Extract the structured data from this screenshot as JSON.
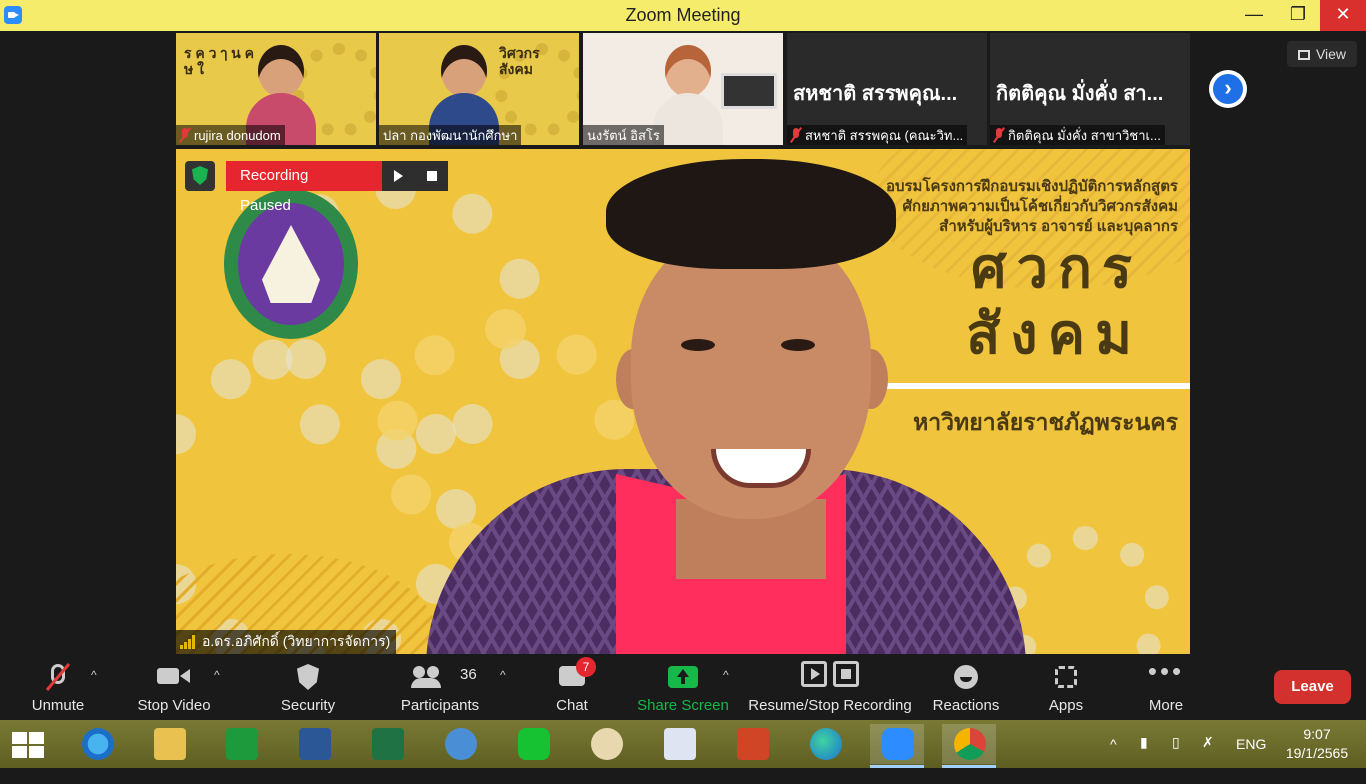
{
  "window": {
    "title": "Zoom Meeting"
  },
  "gallery": {
    "view_label": "View",
    "tiles": [
      {
        "name": "rujira donudom",
        "poster": "ร ค ว ๅ น ค ษ ใ"
      },
      {
        "name": "ปลา กองพัฒนานักศึกษา",
        "poster": "วิศวกร สังคม"
      },
      {
        "name": "นงรัตน์ อิสโร"
      },
      {
        "name": "สหชาติ สรรพคุณ (คณะวิท...",
        "big": "สหชาติ สรรพคุณ..."
      },
      {
        "name": "กิตติคุณ  มั่งคั่ง สาขาวิชาเ...",
        "big": "กิตติคุณ  มั่งคั่ง สา..."
      }
    ]
  },
  "main": {
    "recording_label": "Recording Paused",
    "speaker_name": "อ.ดร.อภิศักดิ์ (วิทยาการจัดการ)",
    "poster": {
      "line1": "อบรมโครงการฝึกอบรมเชิงปฏิบัติการหลักสูตร",
      "line2": "ศักยภาพความเป็นโค้ชเกี่ยวกับวิศวกรสังคม",
      "line3": "สำหรับผู้บริหาร อาจารย์ และบุคลากร",
      "big1": "ศวกร",
      "big2": "สังคม",
      "university": "หาวิทยาลัยราชภัฏพระนคร"
    }
  },
  "toolbar": {
    "unmute": "Unmute",
    "stop_video": "Stop Video",
    "security": "Security",
    "participants": "Participants",
    "participants_count": "36",
    "chat": "Chat",
    "chat_badge": "7",
    "share_screen": "Share Screen",
    "recording": "Resume/Stop Recording",
    "reactions": "Reactions",
    "apps": "Apps",
    "more": "More",
    "leave": "Leave"
  },
  "taskbar": {
    "apps": [
      "internet-explorer",
      "file-explorer",
      "microsoft-store",
      "word",
      "excel",
      "math-input",
      "line",
      "paint",
      "lisrel",
      "powerpoint",
      "edge",
      "zoom",
      "chrome"
    ],
    "lang": "ENG",
    "time": "9:07",
    "date": "19/1/2565"
  }
}
